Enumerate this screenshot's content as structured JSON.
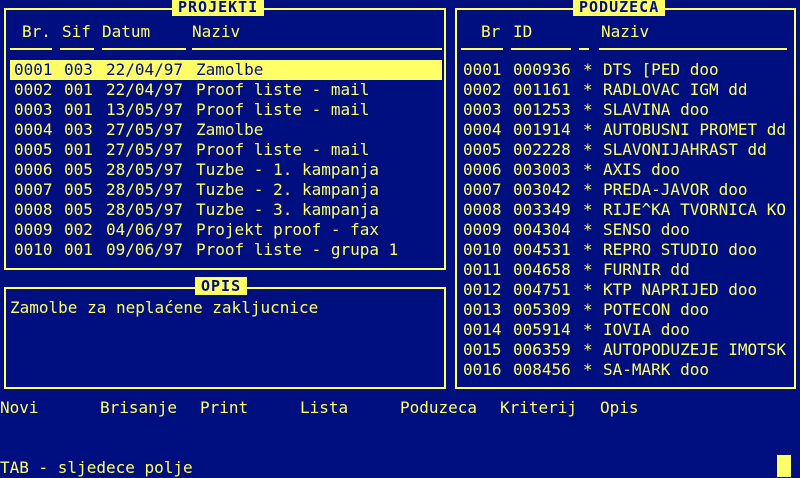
{
  "projekti": {
    "title": "PROJEKTI",
    "col_br": "Br.",
    "col_sif": "Sif",
    "col_datum": "Datum",
    "col_naziv": "Naziv",
    "rows": [
      {
        "br": "0001",
        "sif": "003",
        "datum": "22/04/97",
        "naziv": "Zamolbe"
      },
      {
        "br": "0002",
        "sif": "001",
        "datum": "22/04/97",
        "naziv": "Proof liste - mail"
      },
      {
        "br": "0003",
        "sif": "001",
        "datum": "13/05/97",
        "naziv": "Proof liste - mail"
      },
      {
        "br": "0004",
        "sif": "003",
        "datum": "27/05/97",
        "naziv": "Zamolbe"
      },
      {
        "br": "0005",
        "sif": "001",
        "datum": "27/05/97",
        "naziv": "Proof liste - mail"
      },
      {
        "br": "0006",
        "sif": "005",
        "datum": "28/05/97",
        "naziv": "Tuzbe - 1. kampanja"
      },
      {
        "br": "0007",
        "sif": "005",
        "datum": "28/05/97",
        "naziv": "Tuzbe - 2. kampanja"
      },
      {
        "br": "0008",
        "sif": "005",
        "datum": "28/05/97",
        "naziv": "Tuzbe - 3. kampanja"
      },
      {
        "br": "0009",
        "sif": "002",
        "datum": "04/06/97",
        "naziv": "Projekt proof - fax"
      },
      {
        "br": "0010",
        "sif": "001",
        "datum": "09/06/97",
        "naziv": "Proof liste - grupa 1"
      }
    ]
  },
  "opis": {
    "title": "OPIS",
    "text": "Zamolbe za neplaćene zakljucnice"
  },
  "poduzeca": {
    "title": "PODUZECA",
    "col_br": "Br",
    "col_id": "ID",
    "col_naziv": "Naziv",
    "rows": [
      {
        "br": "0001",
        "id": "000936",
        "mark": "*",
        "naziv": "DTS [PED doo"
      },
      {
        "br": "0002",
        "id": "001161",
        "mark": "*",
        "naziv": "RADLOVAC IGM dd"
      },
      {
        "br": "0003",
        "id": "001253",
        "mark": "*",
        "naziv": "SLAVINA doo"
      },
      {
        "br": "0004",
        "id": "001914",
        "mark": "*",
        "naziv": "AUTOBUSNI PROMET dd"
      },
      {
        "br": "0005",
        "id": "002228",
        "mark": "*",
        "naziv": "SLAVONIJAHRAST dd"
      },
      {
        "br": "0006",
        "id": "003003",
        "mark": "*",
        "naziv": "AXIS doo"
      },
      {
        "br": "0007",
        "id": "003042",
        "mark": "*",
        "naziv": "PREDA-JAVOR doo"
      },
      {
        "br": "0008",
        "id": "003349",
        "mark": "*",
        "naziv": "RIJE^KA TVORNICA KO"
      },
      {
        "br": "0009",
        "id": "004304",
        "mark": "*",
        "naziv": "SENSO doo"
      },
      {
        "br": "0010",
        "id": "004531",
        "mark": "*",
        "naziv": "REPRO STUDIO doo"
      },
      {
        "br": "0011",
        "id": "004658",
        "mark": "*",
        "naziv": "FURNIR dd"
      },
      {
        "br": "0012",
        "id": "004751",
        "mark": "*",
        "naziv": "KTP NAPRIJED doo"
      },
      {
        "br": "0013",
        "id": "005309",
        "mark": "*",
        "naziv": "POTECON doo"
      },
      {
        "br": "0014",
        "id": "005914",
        "mark": "*",
        "naziv": "IOVIA doo"
      },
      {
        "br": "0015",
        "id": "006359",
        "mark": "*",
        "naziv": "AUTOPODUZEJE IMOTSK"
      },
      {
        "br": "0016",
        "id": "008456",
        "mark": "*",
        "naziv": "SA-MARK doo"
      }
    ]
  },
  "menu": {
    "novi": "Novi",
    "brisanje": "Brisanje",
    "print": "Print",
    "lista": "Lista",
    "poduzeca": "Poduzeca",
    "kriterij": "Kriterij",
    "opis": "Opis"
  },
  "status": {
    "hint": "TAB - sljedece polje"
  },
  "colors": {
    "background": "#000f80",
    "foreground": "#ffff66"
  }
}
